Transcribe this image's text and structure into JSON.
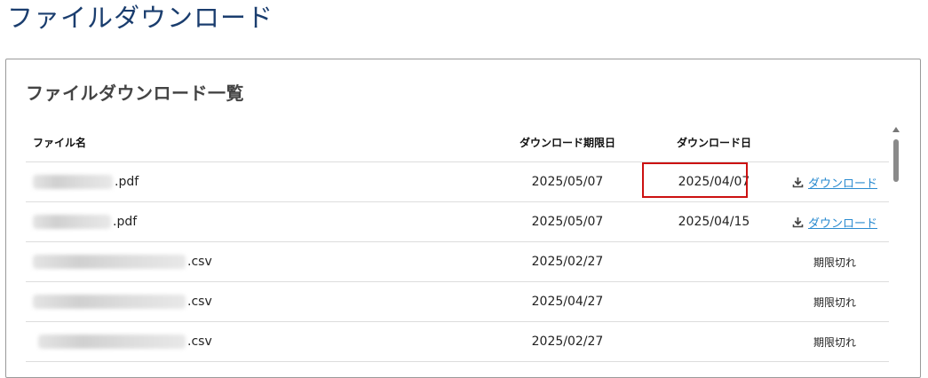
{
  "page": {
    "title": "ファイルダウンロード"
  },
  "card": {
    "title": "ファイルダウンロード一覧"
  },
  "table": {
    "headers": {
      "name": "ファイル名",
      "deadline": "ダウンロード期限日",
      "date": "ダウンロード日",
      "action": ""
    },
    "rows": [
      {
        "name_ext": ".pdf",
        "deadline": "2025/05/07",
        "date": "2025/04/07",
        "action": "ダウンロード",
        "status": ""
      },
      {
        "name_ext": ".pdf",
        "deadline": "2025/05/07",
        "date": "2025/04/15",
        "action": "ダウンロード",
        "status": ""
      },
      {
        "name_ext": ".csv",
        "deadline": "2025/02/27",
        "date": "",
        "action": "",
        "status": "期限切れ"
      },
      {
        "name_ext": ".csv",
        "deadline": "2025/04/27",
        "date": "",
        "action": "",
        "status": "期限切れ"
      },
      {
        "name_ext": ".csv",
        "deadline": "2025/02/27",
        "date": "",
        "action": "",
        "status": "期限切れ"
      }
    ]
  },
  "colors": {
    "title": "#1a3d6e",
    "link": "#2a8bd0",
    "highlight": "#cc1111"
  },
  "icons": {
    "download": "download-icon",
    "scroll_up": "arrow-up-icon"
  }
}
